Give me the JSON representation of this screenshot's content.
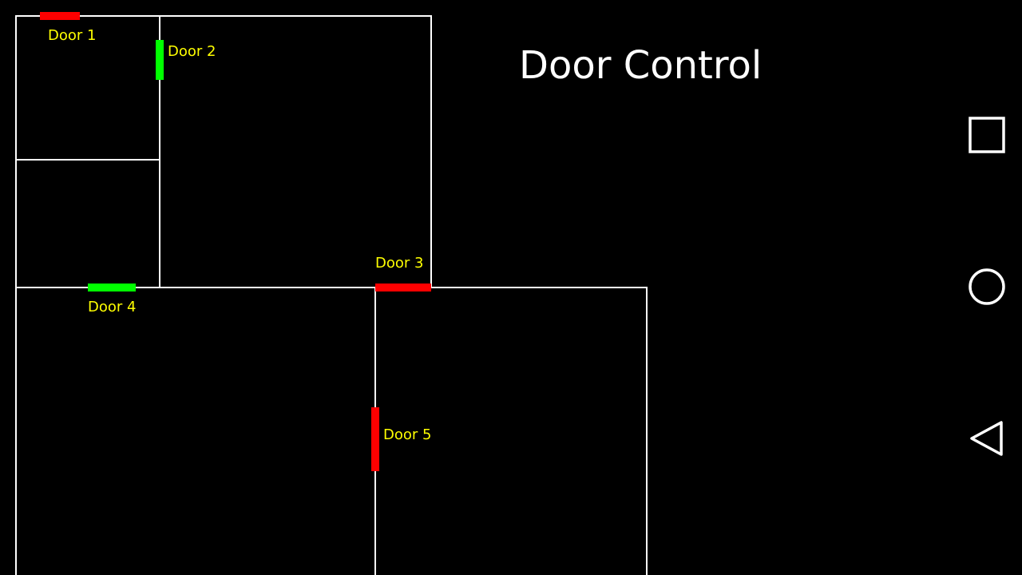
{
  "app": {
    "title": "Door Control"
  },
  "colors": {
    "background": "#000000",
    "wall": "#ffffff",
    "label": "#ffff00",
    "door_open": "#00ff00",
    "door_closed": "#ff0000",
    "nav_icon": "#ffffff"
  },
  "doors": [
    {
      "label": "Door 1",
      "status": "closed"
    },
    {
      "label": "Door 2",
      "status": "open"
    },
    {
      "label": "Door 3",
      "status": "closed"
    },
    {
      "label": "Door 4",
      "status": "open"
    },
    {
      "label": "Door 5",
      "status": "closed"
    }
  ],
  "navigation": {
    "buttons": [
      {
        "icon": "recents-square-icon"
      },
      {
        "icon": "home-circle-icon"
      },
      {
        "icon": "back-triangle-icon"
      }
    ]
  }
}
